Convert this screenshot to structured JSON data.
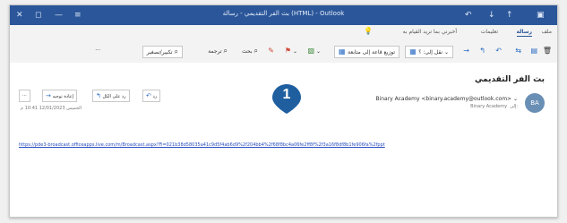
{
  "window": {
    "title": "بث الفر التقديمي - رسالة (HTML) - Outlook",
    "controls": {
      "close": "✕",
      "maximize": "◻",
      "minimize": "—",
      "menu": "≡"
    }
  },
  "ribbon": {
    "tabs": [
      {
        "label": "ملف",
        "active": false
      },
      {
        "label": "رسالة",
        "active": true
      },
      {
        "label": "تعليمات",
        "active": false
      },
      {
        "label": "أخبرني بما تريد القيام به",
        "active": false
      }
    ]
  },
  "toolbar": {
    "move_label": "نقل إلى: ؟",
    "quick_steps_label": "توزيع قاعة إلى متابعة",
    "find_label": "بحث",
    "translate_label": "ترجمة",
    "zoom_label": "تكبير/تصغير",
    "more_label": "···"
  },
  "message": {
    "subject": "بث الفر التقديمي",
    "avatar_initials": "BA",
    "sender": "Binary Academy <binary.academy@outlook.com> ⌄",
    "to_label": "إلى:",
    "to": "Binary Academy",
    "date": "الخميس 12/01/2023 10:41 م",
    "actions": {
      "reply": "رد",
      "reply_all": "رد على الكل",
      "forward": "إعادة توجيه",
      "more": "···"
    },
    "link": "https://pde3-broadcast.officeapps.live.com/m/Broadcast.aspx?Fi=021b38d58035a41c9d5f4ab6d9%2f204bb4%2f68f8bc4a06fe2ff8f%2f3a16f8df8b1fe906fa%2fppt"
  },
  "badge": {
    "number": "1",
    "color": "#1f5fa0"
  },
  "colors": {
    "titlebar": "#2b579a",
    "link": "#2b4fbf"
  }
}
